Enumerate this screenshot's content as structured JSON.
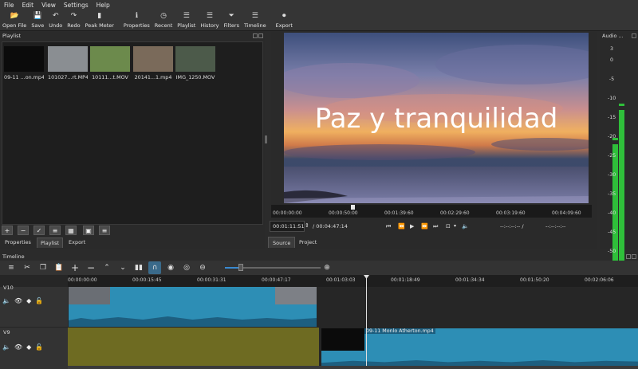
{
  "menu": [
    "File",
    "Edit",
    "View",
    "Settings",
    "Help"
  ],
  "toolbar": [
    {
      "label": "Open File",
      "icon": "folder-icon"
    },
    {
      "label": "Save",
      "icon": "save-icon"
    },
    {
      "label": "Undo",
      "icon": "undo-icon"
    },
    {
      "label": "Redo",
      "icon": "redo-icon"
    },
    {
      "label": "Peak Meter",
      "icon": "peak-meter-icon"
    },
    {
      "label": "Properties",
      "icon": "info-icon"
    },
    {
      "label": "Recent",
      "icon": "clock-icon"
    },
    {
      "label": "Playlist",
      "icon": "list-icon"
    },
    {
      "label": "History",
      "icon": "history-icon"
    },
    {
      "label": "Filters",
      "icon": "filter-icon"
    },
    {
      "label": "Timeline",
      "icon": "timeline-icon"
    },
    {
      "label": "Export",
      "icon": "export-icon"
    }
  ],
  "playlist": {
    "title": "Playlist",
    "items": [
      {
        "name": "09-11 ...on.mp4",
        "color": "#0b0b0b"
      },
      {
        "name": "101027...rt.MP4",
        "color": "#8a8e92"
      },
      {
        "name": "10111...t.MOV",
        "color": "#6c8a4c"
      },
      {
        "name": "20141...1.mp4",
        "color": "#7a6a5a"
      },
      {
        "name": "IMG_1250.MOV",
        "color": "#4c5a4a"
      }
    ],
    "tabs": [
      "Properties",
      "Playlist",
      "Export"
    ],
    "active_tab": "Playlist"
  },
  "viewer": {
    "overlay_text": "Paz y tranquilidad",
    "ruler": [
      "00:00:00:00",
      "00:00:50:00",
      "00:01:39:60",
      "00:02:29:60",
      "00:03:19:60",
      "00:04:09:60"
    ],
    "position": "00:01:11:51",
    "duration": "/ 00:04:47:14",
    "in_point": "--:--:--:-- /",
    "out_point": "--:--:--:--",
    "tabs": [
      "Source",
      "Project"
    ],
    "active_tab": "Source"
  },
  "audio": {
    "title": "Audio ...",
    "scale": [
      "3",
      "0",
      "-5",
      "-10",
      "-15",
      "-20",
      "-25",
      "-30",
      "-35",
      "-40",
      "-45",
      "-50"
    ],
    "meter_color": "#2fbf3a",
    "left_level_db": -22,
    "right_level_db": -13
  },
  "timeline": {
    "title": "Timeline",
    "ruler": [
      "00:00:00:00",
      "00:00:15:45",
      "00:00:31:31",
      "00:00:47:17",
      "00:01:03:03",
      "00:01:18:49",
      "00:01:34:34",
      "00:01:50:20",
      "00:02:06:06"
    ],
    "tracks": [
      {
        "name": "V10"
      },
      {
        "name": "V9"
      }
    ],
    "clip_label": "09-11 Monlo Atherton.mp4",
    "colors": {
      "clip": "#2d8eb5",
      "track_v9": "#6e6b22",
      "playhead": "#e0e0e0"
    }
  }
}
